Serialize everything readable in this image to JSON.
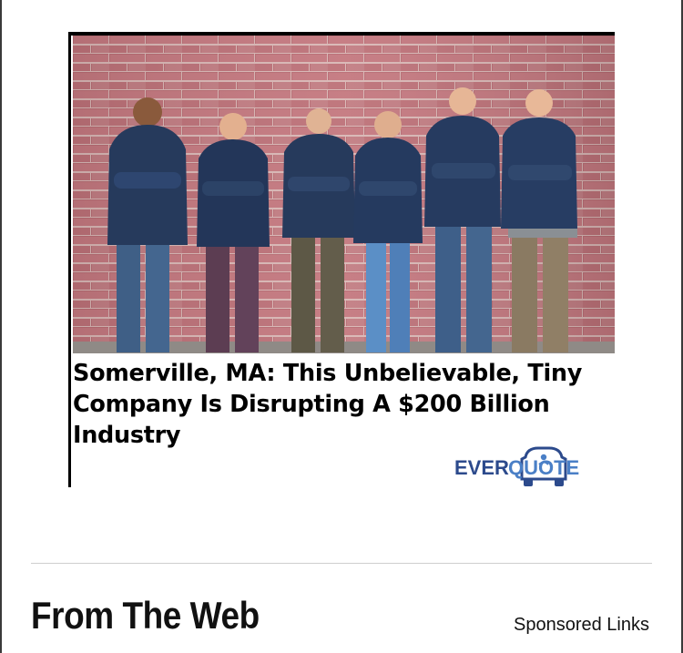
{
  "ad": {
    "headline": "Somerville, MA: This Unbelievable, Tiny Company Is Disrupting A $200 Billion Industry",
    "image_alt": "Six people in navy hoodies with arms crossed standing in front of a red brick wall",
    "advertiser": {
      "logo_text_left": "EVER",
      "logo_text_right": "QUOTE",
      "colors": {
        "ever": "#2c4a8c",
        "quote": "#4a7fc6"
      }
    }
  },
  "section": {
    "title": "From The Web",
    "sponsored_label": "Sponsored Links"
  },
  "colors": {
    "brick": "#b86a70",
    "hoodie": "#263a5c",
    "text": "#000000",
    "divider": "#cfcfcf"
  }
}
